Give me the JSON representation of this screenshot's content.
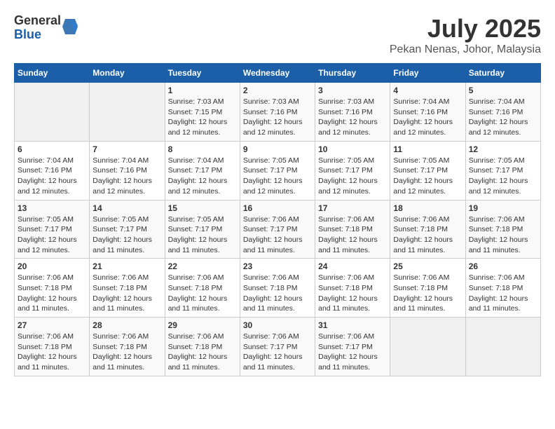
{
  "header": {
    "logo": {
      "line1": "General",
      "line2": "Blue"
    },
    "title": "July 2025",
    "location": "Pekan Nenas, Johor, Malaysia"
  },
  "calendar": {
    "days_of_week": [
      "Sunday",
      "Monday",
      "Tuesday",
      "Wednesday",
      "Thursday",
      "Friday",
      "Saturday"
    ],
    "weeks": [
      [
        {
          "day": "",
          "info": ""
        },
        {
          "day": "",
          "info": ""
        },
        {
          "day": "1",
          "info": "Sunrise: 7:03 AM\nSunset: 7:15 PM\nDaylight: 12 hours\nand 12 minutes."
        },
        {
          "day": "2",
          "info": "Sunrise: 7:03 AM\nSunset: 7:16 PM\nDaylight: 12 hours\nand 12 minutes."
        },
        {
          "day": "3",
          "info": "Sunrise: 7:03 AM\nSunset: 7:16 PM\nDaylight: 12 hours\nand 12 minutes."
        },
        {
          "day": "4",
          "info": "Sunrise: 7:04 AM\nSunset: 7:16 PM\nDaylight: 12 hours\nand 12 minutes."
        },
        {
          "day": "5",
          "info": "Sunrise: 7:04 AM\nSunset: 7:16 PM\nDaylight: 12 hours\nand 12 minutes."
        }
      ],
      [
        {
          "day": "6",
          "info": "Sunrise: 7:04 AM\nSunset: 7:16 PM\nDaylight: 12 hours\nand 12 minutes."
        },
        {
          "day": "7",
          "info": "Sunrise: 7:04 AM\nSunset: 7:16 PM\nDaylight: 12 hours\nand 12 minutes."
        },
        {
          "day": "8",
          "info": "Sunrise: 7:04 AM\nSunset: 7:17 PM\nDaylight: 12 hours\nand 12 minutes."
        },
        {
          "day": "9",
          "info": "Sunrise: 7:05 AM\nSunset: 7:17 PM\nDaylight: 12 hours\nand 12 minutes."
        },
        {
          "day": "10",
          "info": "Sunrise: 7:05 AM\nSunset: 7:17 PM\nDaylight: 12 hours\nand 12 minutes."
        },
        {
          "day": "11",
          "info": "Sunrise: 7:05 AM\nSunset: 7:17 PM\nDaylight: 12 hours\nand 12 minutes."
        },
        {
          "day": "12",
          "info": "Sunrise: 7:05 AM\nSunset: 7:17 PM\nDaylight: 12 hours\nand 12 minutes."
        }
      ],
      [
        {
          "day": "13",
          "info": "Sunrise: 7:05 AM\nSunset: 7:17 PM\nDaylight: 12 hours\nand 12 minutes."
        },
        {
          "day": "14",
          "info": "Sunrise: 7:05 AM\nSunset: 7:17 PM\nDaylight: 12 hours\nand 11 minutes."
        },
        {
          "day": "15",
          "info": "Sunrise: 7:05 AM\nSunset: 7:17 PM\nDaylight: 12 hours\nand 11 minutes."
        },
        {
          "day": "16",
          "info": "Sunrise: 7:06 AM\nSunset: 7:17 PM\nDaylight: 12 hours\nand 11 minutes."
        },
        {
          "day": "17",
          "info": "Sunrise: 7:06 AM\nSunset: 7:18 PM\nDaylight: 12 hours\nand 11 minutes."
        },
        {
          "day": "18",
          "info": "Sunrise: 7:06 AM\nSunset: 7:18 PM\nDaylight: 12 hours\nand 11 minutes."
        },
        {
          "day": "19",
          "info": "Sunrise: 7:06 AM\nSunset: 7:18 PM\nDaylight: 12 hours\nand 11 minutes."
        }
      ],
      [
        {
          "day": "20",
          "info": "Sunrise: 7:06 AM\nSunset: 7:18 PM\nDaylight: 12 hours\nand 11 minutes."
        },
        {
          "day": "21",
          "info": "Sunrise: 7:06 AM\nSunset: 7:18 PM\nDaylight: 12 hours\nand 11 minutes."
        },
        {
          "day": "22",
          "info": "Sunrise: 7:06 AM\nSunset: 7:18 PM\nDaylight: 12 hours\nand 11 minutes."
        },
        {
          "day": "23",
          "info": "Sunrise: 7:06 AM\nSunset: 7:18 PM\nDaylight: 12 hours\nand 11 minutes."
        },
        {
          "day": "24",
          "info": "Sunrise: 7:06 AM\nSunset: 7:18 PM\nDaylight: 12 hours\nand 11 minutes."
        },
        {
          "day": "25",
          "info": "Sunrise: 7:06 AM\nSunset: 7:18 PM\nDaylight: 12 hours\nand 11 minutes."
        },
        {
          "day": "26",
          "info": "Sunrise: 7:06 AM\nSunset: 7:18 PM\nDaylight: 12 hours\nand 11 minutes."
        }
      ],
      [
        {
          "day": "27",
          "info": "Sunrise: 7:06 AM\nSunset: 7:18 PM\nDaylight: 12 hours\nand 11 minutes."
        },
        {
          "day": "28",
          "info": "Sunrise: 7:06 AM\nSunset: 7:18 PM\nDaylight: 12 hours\nand 11 minutes."
        },
        {
          "day": "29",
          "info": "Sunrise: 7:06 AM\nSunset: 7:18 PM\nDaylight: 12 hours\nand 11 minutes."
        },
        {
          "day": "30",
          "info": "Sunrise: 7:06 AM\nSunset: 7:17 PM\nDaylight: 12 hours\nand 11 minutes."
        },
        {
          "day": "31",
          "info": "Sunrise: 7:06 AM\nSunset: 7:17 PM\nDaylight: 12 hours\nand 11 minutes."
        },
        {
          "day": "",
          "info": ""
        },
        {
          "day": "",
          "info": ""
        }
      ]
    ]
  }
}
